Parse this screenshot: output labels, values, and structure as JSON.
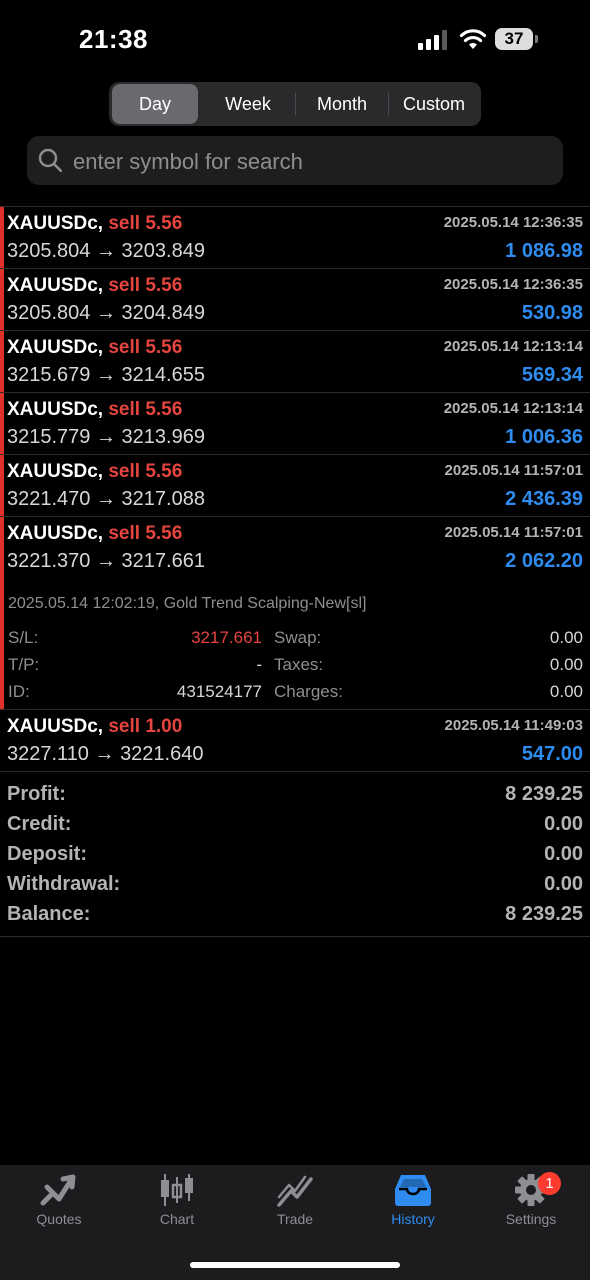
{
  "status_bar": {
    "time": "21:38",
    "battery": "37"
  },
  "segment": {
    "tabs": [
      "Day",
      "Week",
      "Month",
      "Custom"
    ],
    "selected": "Day"
  },
  "search": {
    "placeholder": "enter symbol for search",
    "value": ""
  },
  "deals": [
    {
      "symbol": "XAUUSDc,",
      "direction": "sell 5.56",
      "open": "3205.804",
      "close": "3203.849",
      "time": "2025.05.14 12:36:35",
      "profit": "1 086.98"
    },
    {
      "symbol": "XAUUSDc,",
      "direction": "sell 5.56",
      "open": "3205.804",
      "close": "3204.849",
      "time": "2025.05.14 12:36:35",
      "profit": "530.98"
    },
    {
      "symbol": "XAUUSDc,",
      "direction": "sell 5.56",
      "open": "3215.679",
      "close": "3214.655",
      "time": "2025.05.14 12:13:14",
      "profit": "569.34"
    },
    {
      "symbol": "XAUUSDc,",
      "direction": "sell 5.56",
      "open": "3215.779",
      "close": "3213.969",
      "time": "2025.05.14 12:13:14",
      "profit": "1 006.36"
    },
    {
      "symbol": "XAUUSDc,",
      "direction": "sell 5.56",
      "open": "3221.470",
      "close": "3217.088",
      "time": "2025.05.14 11:57:01",
      "profit": "2 436.39"
    }
  ],
  "expanded_deal": {
    "symbol": "XAUUSDc,",
    "direction": "sell 5.56",
    "open": "3221.370",
    "close": "3217.661",
    "time": "2025.05.14 11:57:01",
    "profit": "2 062.20",
    "comment": "2025.05.14 12:02:19, Gold Trend Scalping-New[sl]",
    "sl_label": "S/L:",
    "sl_value": "3217.661",
    "tp_label": "T/P:",
    "tp_value": "-",
    "id_label": "ID:",
    "id_value": "431524177",
    "swap_label": "Swap:",
    "swap_value": "0.00",
    "taxes_label": "Taxes:",
    "taxes_value": "0.00",
    "charges_label": "Charges:",
    "charges_value": "0.00"
  },
  "last_deal": {
    "symbol": "XAUUSDc,",
    "direction": "sell 1.00",
    "open": "3227.110",
    "close": "3221.640",
    "time": "2025.05.14 11:49:03",
    "profit": "547.00"
  },
  "arrow": "→",
  "summary": [
    {
      "label": "Profit:",
      "value": "8 239.25"
    },
    {
      "label": "Credit:",
      "value": "0.00"
    },
    {
      "label": "Deposit:",
      "value": "0.00"
    },
    {
      "label": "Withdrawal:",
      "value": "0.00"
    },
    {
      "label": "Balance:",
      "value": "8 239.25"
    }
  ],
  "tabbar": {
    "items": [
      {
        "label": "Quotes",
        "icon": "quotes-icon"
      },
      {
        "label": "Chart",
        "icon": "chart-icon"
      },
      {
        "label": "Trade",
        "icon": "trade-icon"
      },
      {
        "label": "History",
        "icon": "history-icon"
      },
      {
        "label": "Settings",
        "icon": "settings-icon"
      }
    ],
    "active": "History",
    "settings_badge": "1"
  },
  "colors": {
    "sell": "#e5453e",
    "profit": "#2e8cf0",
    "accent": "#2e8cf0"
  }
}
